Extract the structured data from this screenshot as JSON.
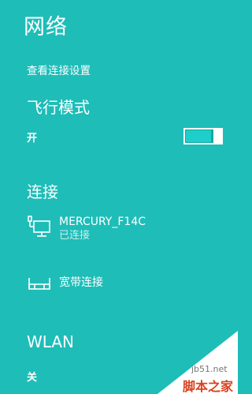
{
  "header": {
    "title": "网络"
  },
  "settings": {
    "link_label": "查看连接设置"
  },
  "airplane": {
    "heading": "飞行模式",
    "state": "开"
  },
  "connections": {
    "heading": "连接",
    "items": [
      {
        "name": "MERCURY_F14C",
        "status": "已连接",
        "icon": "wired-network-icon"
      },
      {
        "name": "宽带连接",
        "status": "",
        "icon": "broadband-icon"
      }
    ]
  },
  "wlan": {
    "heading": "WLAN",
    "state": "关"
  },
  "watermark": {
    "url": "jb51.net",
    "brand": "脚本之家"
  },
  "colors": {
    "background": "#1ebdb8",
    "text": "#ffffff",
    "toggle_fill": "#1ecfc9"
  }
}
